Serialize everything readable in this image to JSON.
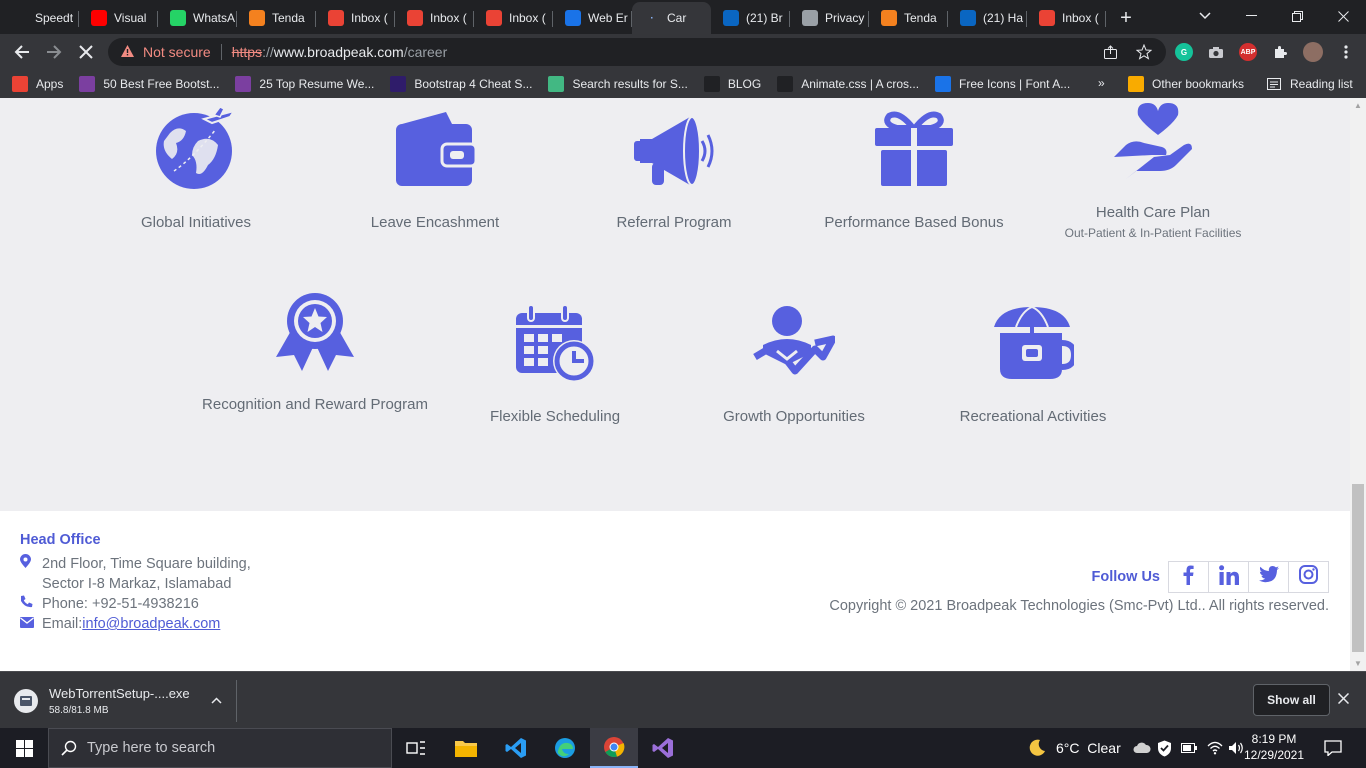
{
  "browser": {
    "tabs": [
      {
        "title": "Speedt",
        "favicon": "speedtest-icon",
        "color": "#202124"
      },
      {
        "title": "Visual",
        "favicon": "youtube-icon",
        "color": "#ff0000"
      },
      {
        "title": "WhatsA",
        "favicon": "whatsapp-icon",
        "color": "#25d366"
      },
      {
        "title": "Tenda",
        "favicon": "tenda-icon",
        "color": "#f4811f"
      },
      {
        "title": "Inbox (",
        "favicon": "gmail-icon",
        "color": "#ea4335"
      },
      {
        "title": "Inbox (",
        "favicon": "gmail-icon",
        "color": "#ea4335"
      },
      {
        "title": "Inbox (",
        "favicon": "gmail-icon",
        "color": "#ea4335"
      },
      {
        "title": "Web Er",
        "favicon": "web-icon",
        "color": "#1a73e8"
      },
      {
        "title": "Car",
        "favicon": "loading-icon",
        "color": "#8ab4f8",
        "active": true
      },
      {
        "title": "(21) Br",
        "favicon": "linkedin-icon",
        "color": "#0a66c2"
      },
      {
        "title": "Privacy",
        "favicon": "globe-icon",
        "color": "#9aa0a6"
      },
      {
        "title": "Tenda",
        "favicon": "tenda-icon",
        "color": "#f4811f"
      },
      {
        "title": "(21) Ha",
        "favicon": "linkedin-icon",
        "color": "#0a66c2"
      },
      {
        "title": "Inbox (",
        "favicon": "gmail-icon",
        "color": "#ea4335"
      }
    ],
    "address": {
      "security": "Not secure",
      "scheme": "https",
      "rest_prefix": "://",
      "host": "www.broadpeak.com",
      "path": "/career"
    },
    "bookmarks": [
      {
        "label": "Apps",
        "icon": "apps-grid-icon",
        "color": "#ea4335"
      },
      {
        "label": "50 Best Free Bootst...",
        "icon": "colorlib-icon",
        "color": "#7b3fa0"
      },
      {
        "label": "25 Top Resume We...",
        "icon": "colorlib-icon",
        "color": "#7b3fa0"
      },
      {
        "label": "Bootstrap 4 Cheat S...",
        "icon": "hostinger-icon",
        "color": "#2f1c6a"
      },
      {
        "label": "Search results for S...",
        "icon": "vue-icon",
        "color": "#42b883"
      },
      {
        "label": "BLOG",
        "icon": "a-logo-icon",
        "color": "#202124"
      },
      {
        "label": "Animate.css | A cros...",
        "icon": "animate-icon",
        "color": "#202124"
      },
      {
        "label": "Free Icons | Font A...",
        "icon": "flag-icon",
        "color": "#1a73e8"
      }
    ],
    "bookmarks_more": "»",
    "other_bookmarks": "Other bookmarks",
    "reading_list": "Reading list"
  },
  "page": {
    "accent": "#5760df",
    "benefits_row1": [
      {
        "label": "Global Initiatives",
        "icon": "globe-plane-icon"
      },
      {
        "label": "Leave Encashment",
        "icon": "wallet-icon"
      },
      {
        "label": "Referral Program",
        "icon": "megaphone-icon"
      },
      {
        "label": "Performance Based Bonus",
        "icon": "gift-icon"
      },
      {
        "label": "Health Care Plan",
        "sub": "Out-Patient & In-Patient Facilities",
        "icon": "heart-hand-icon"
      }
    ],
    "benefits_row2": [
      {
        "label": "Recognition and Reward Program",
        "icon": "award-badge-icon"
      },
      {
        "label": "Flexible Scheduling",
        "icon": "calendar-clock-icon"
      },
      {
        "label": "Growth Opportunities",
        "icon": "person-growth-icon"
      },
      {
        "label": "Recreational Activities",
        "icon": "coffee-cup-icon"
      }
    ],
    "footer": {
      "head_office": "Head Office",
      "address_line1": "2nd Floor, Time Square building,",
      "address_line2": "Sector I-8 Markaz, Islamabad",
      "phone": "Phone: +92-51-4938216",
      "email_label": "Email: ",
      "email": "info@broadpeak.com",
      "follow_us": "Follow Us",
      "copyright": "Copyright © 2021 Broadpeak Technologies (Smc-Pvt) Ltd.. All rights reserved."
    }
  },
  "download": {
    "filename": "WebTorrentSetup-....exe",
    "progress": "58.8/81.8 MB",
    "show_all": "Show all"
  },
  "taskbar": {
    "search_placeholder": "Type here to search",
    "weather": "6°C  Clear",
    "time": "8:19 PM",
    "date": "12/29/2021"
  }
}
